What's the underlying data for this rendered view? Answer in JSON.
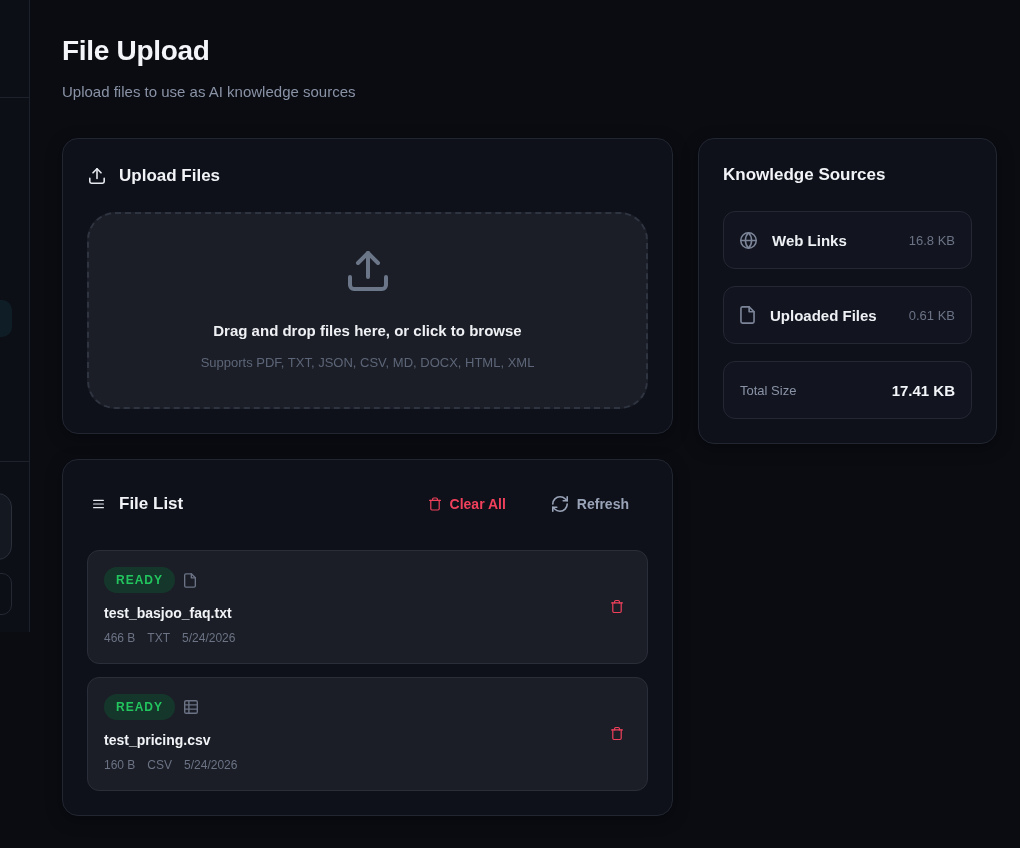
{
  "page": {
    "title": "File Upload",
    "subtitle": "Upload files to use as AI knowledge sources"
  },
  "upload_card": {
    "title": "Upload Files",
    "dropzone": {
      "prompt": "Drag and drop files here, or click to browse",
      "hint": "Supports PDF, TXT, JSON, CSV, MD, DOCX, HTML, XML"
    }
  },
  "file_list": {
    "title": "File List",
    "actions": [
      {
        "kind": "clear",
        "label": "Clear All"
      },
      {
        "kind": "refresh",
        "label": "Refresh"
      }
    ],
    "files": [
      {
        "status": "READY",
        "kind": "text",
        "name": "test_basjoo_faq.txt",
        "size": "466 B",
        "type": "TXT",
        "date": "5/24/2026"
      },
      {
        "status": "READY",
        "kind": "table",
        "name": "test_pricing.csv",
        "size": "160 B",
        "type": "CSV",
        "date": "5/24/2026"
      }
    ]
  },
  "knowledge_sources": {
    "title": "Knowledge Sources",
    "sources": [
      {
        "kind": "web",
        "label": "Web Links",
        "size": "16.8 KB"
      },
      {
        "kind": "file",
        "label": "Uploaded Files",
        "size": "0.61 KB"
      }
    ],
    "total": {
      "label": "Total Size",
      "value": "17.41 KB"
    }
  }
}
